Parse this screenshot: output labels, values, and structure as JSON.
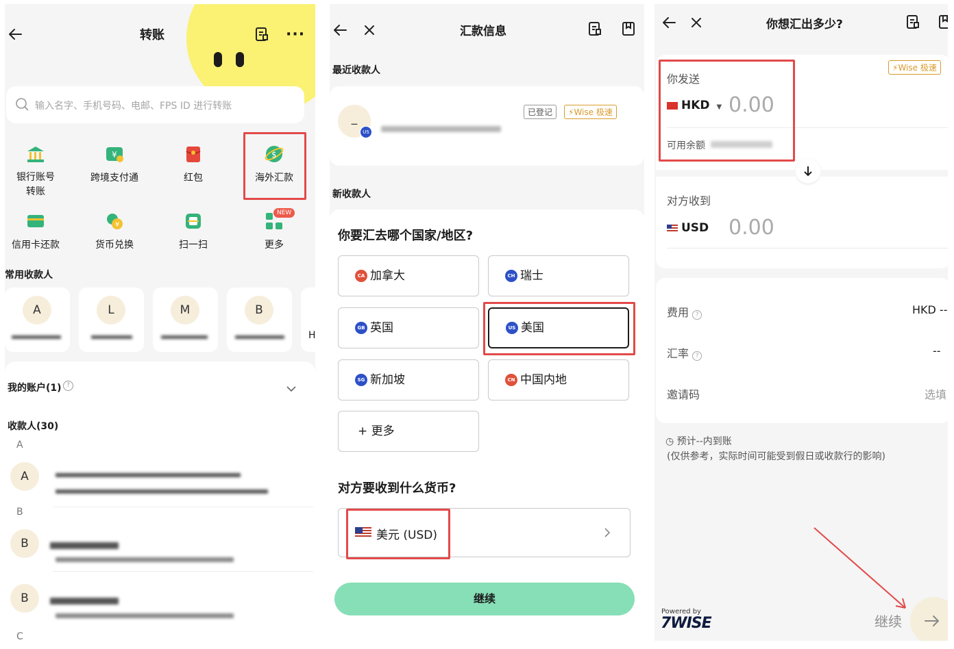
{
  "panel1": {
    "title": "转账",
    "search_placeholder": "输入名字、手机号码、电邮、FPS ID 进行转账",
    "services": [
      {
        "label": "银行账号\n转账",
        "icon": "bank-icon"
      },
      {
        "label": "跨境支付通",
        "icon": "cross-border-pay-icon"
      },
      {
        "label": "红包",
        "icon": "red-packet-icon"
      },
      {
        "label": "海外汇款",
        "icon": "overseas-remittance-icon"
      },
      {
        "label": "信用卡还款",
        "icon": "credit-card-icon"
      },
      {
        "label": "货币兑换",
        "icon": "currency-exchange-icon"
      },
      {
        "label": "扫一扫",
        "icon": "scan-icon"
      },
      {
        "label": "更多",
        "icon": "more-apps-icon"
      }
    ],
    "new_badge": "NEW",
    "frequent_title": "常用收款人",
    "frequent_payees": [
      "A",
      "L",
      "M",
      "B"
    ],
    "frequent_more_initial": "H",
    "my_accounts": "我的账户(1)",
    "payees_title": "收款人(30)",
    "section_letters": [
      "A",
      "B",
      "C"
    ],
    "payees": [
      {
        "initial": "A"
      },
      {
        "initial": "B"
      },
      {
        "initial": "B"
      }
    ]
  },
  "panel2": {
    "title": "汇款信息",
    "recent_title": "最近收款人",
    "recent_avatar_text": "_",
    "recent_country_badge": "US",
    "tag_registered": "已登记",
    "tag_wise": "Wise 极速",
    "new_payee_title": "新收款人",
    "country_question": "你要汇去哪个国家/地区?",
    "countries": [
      {
        "code": "CA",
        "name": "加拿大",
        "color": "#e0503a"
      },
      {
        "code": "CH",
        "name": "瑞士",
        "color": "#2d50c8"
      },
      {
        "code": "GB",
        "name": "英国",
        "color": "#2d50c8"
      },
      {
        "code": "US",
        "name": "美国",
        "color": "#2d50c8"
      },
      {
        "code": "SG",
        "name": "新加坡",
        "color": "#2d50c8"
      },
      {
        "code": "CN",
        "name": "中国内地",
        "color": "#e0503a"
      }
    ],
    "more_label": "+ 更多",
    "currency_question": "对方要收到什么货币?",
    "currency_value": "美元 (USD)",
    "continue_label": "继续",
    "accent": "#86dfb6"
  },
  "panel3": {
    "title": "你想汇出多少?",
    "wise_tag": "Wise 极速",
    "send_label": "你发送",
    "send_currency": "HKD",
    "send_amount": "0.00",
    "balance_label": "可用余额",
    "receive_label": "对方收到",
    "receive_currency": "USD",
    "receive_amount": "0.00",
    "fee_label": "费用",
    "fee_value": "HKD --",
    "rate_label": "汇率",
    "rate_value": "--",
    "invite_label": "邀请码",
    "invite_value": "选填",
    "eta_line": "预计--内到账",
    "eta_note": "(仅供参考，实际时间可能受到假日或收款行的影响)",
    "powered_by": "Powered by",
    "wise_logo": "7WISE",
    "continue_label": "继续"
  }
}
